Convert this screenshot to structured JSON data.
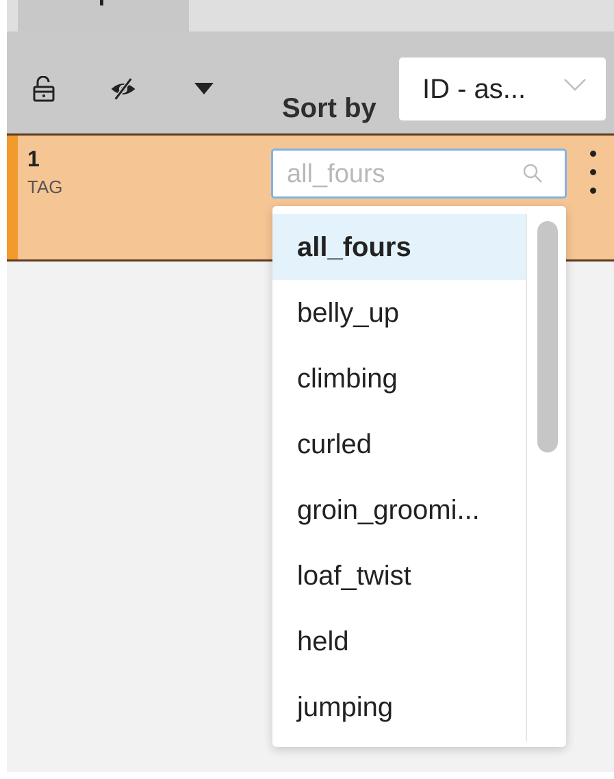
{
  "toolbar": {
    "icons": [
      "unlock-icon",
      "eye-slash-icon",
      "caret-down-icon"
    ],
    "sort_label": "Sort by",
    "sort_value": "ID - as..."
  },
  "row": {
    "id": "1",
    "type": "TAG",
    "accent_color": "#f39a2d",
    "background_color": "#f6c594",
    "input_placeholder": "all_fours"
  },
  "dropdown": {
    "items": [
      {
        "label": "all_fours",
        "selected": true
      },
      {
        "label": "belly_up",
        "selected": false
      },
      {
        "label": "climbing",
        "selected": false
      },
      {
        "label": "curled",
        "selected": false
      },
      {
        "label": "groin_groomi...",
        "selected": false
      },
      {
        "label": "loaf_twist",
        "selected": false
      },
      {
        "label": "held",
        "selected": false
      },
      {
        "label": "jumping",
        "selected": false
      }
    ]
  }
}
